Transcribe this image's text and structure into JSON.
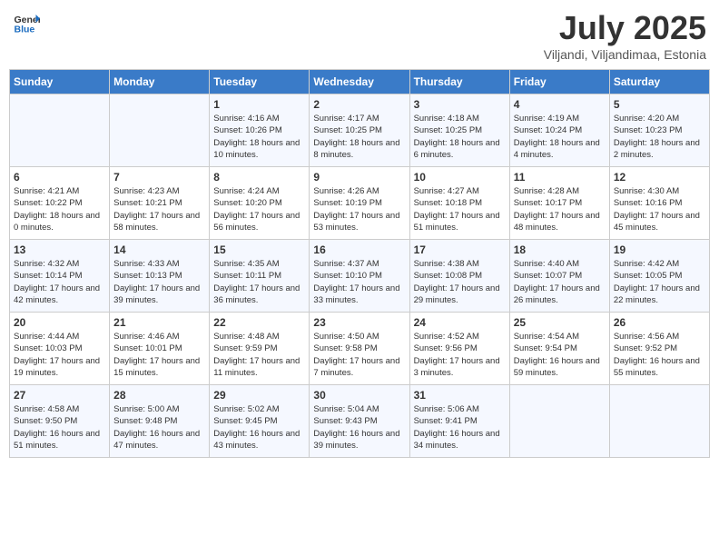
{
  "header": {
    "logo_general": "General",
    "logo_blue": "Blue",
    "month_title": "July 2025",
    "subtitle": "Viljandi, Viljandimaa, Estonia"
  },
  "days_of_week": [
    "Sunday",
    "Monday",
    "Tuesday",
    "Wednesday",
    "Thursday",
    "Friday",
    "Saturday"
  ],
  "weeks": [
    [
      {
        "day": "",
        "detail": ""
      },
      {
        "day": "",
        "detail": ""
      },
      {
        "day": "1",
        "detail": "Sunrise: 4:16 AM\nSunset: 10:26 PM\nDaylight: 18 hours\nand 10 minutes."
      },
      {
        "day": "2",
        "detail": "Sunrise: 4:17 AM\nSunset: 10:25 PM\nDaylight: 18 hours\nand 8 minutes."
      },
      {
        "day": "3",
        "detail": "Sunrise: 4:18 AM\nSunset: 10:25 PM\nDaylight: 18 hours\nand 6 minutes."
      },
      {
        "day": "4",
        "detail": "Sunrise: 4:19 AM\nSunset: 10:24 PM\nDaylight: 18 hours\nand 4 minutes."
      },
      {
        "day": "5",
        "detail": "Sunrise: 4:20 AM\nSunset: 10:23 PM\nDaylight: 18 hours\nand 2 minutes."
      }
    ],
    [
      {
        "day": "6",
        "detail": "Sunrise: 4:21 AM\nSunset: 10:22 PM\nDaylight: 18 hours\nand 0 minutes."
      },
      {
        "day": "7",
        "detail": "Sunrise: 4:23 AM\nSunset: 10:21 PM\nDaylight: 17 hours\nand 58 minutes."
      },
      {
        "day": "8",
        "detail": "Sunrise: 4:24 AM\nSunset: 10:20 PM\nDaylight: 17 hours\nand 56 minutes."
      },
      {
        "day": "9",
        "detail": "Sunrise: 4:26 AM\nSunset: 10:19 PM\nDaylight: 17 hours\nand 53 minutes."
      },
      {
        "day": "10",
        "detail": "Sunrise: 4:27 AM\nSunset: 10:18 PM\nDaylight: 17 hours\nand 51 minutes."
      },
      {
        "day": "11",
        "detail": "Sunrise: 4:28 AM\nSunset: 10:17 PM\nDaylight: 17 hours\nand 48 minutes."
      },
      {
        "day": "12",
        "detail": "Sunrise: 4:30 AM\nSunset: 10:16 PM\nDaylight: 17 hours\nand 45 minutes."
      }
    ],
    [
      {
        "day": "13",
        "detail": "Sunrise: 4:32 AM\nSunset: 10:14 PM\nDaylight: 17 hours\nand 42 minutes."
      },
      {
        "day": "14",
        "detail": "Sunrise: 4:33 AM\nSunset: 10:13 PM\nDaylight: 17 hours\nand 39 minutes."
      },
      {
        "day": "15",
        "detail": "Sunrise: 4:35 AM\nSunset: 10:11 PM\nDaylight: 17 hours\nand 36 minutes."
      },
      {
        "day": "16",
        "detail": "Sunrise: 4:37 AM\nSunset: 10:10 PM\nDaylight: 17 hours\nand 33 minutes."
      },
      {
        "day": "17",
        "detail": "Sunrise: 4:38 AM\nSunset: 10:08 PM\nDaylight: 17 hours\nand 29 minutes."
      },
      {
        "day": "18",
        "detail": "Sunrise: 4:40 AM\nSunset: 10:07 PM\nDaylight: 17 hours\nand 26 minutes."
      },
      {
        "day": "19",
        "detail": "Sunrise: 4:42 AM\nSunset: 10:05 PM\nDaylight: 17 hours\nand 22 minutes."
      }
    ],
    [
      {
        "day": "20",
        "detail": "Sunrise: 4:44 AM\nSunset: 10:03 PM\nDaylight: 17 hours\nand 19 minutes."
      },
      {
        "day": "21",
        "detail": "Sunrise: 4:46 AM\nSunset: 10:01 PM\nDaylight: 17 hours\nand 15 minutes."
      },
      {
        "day": "22",
        "detail": "Sunrise: 4:48 AM\nSunset: 9:59 PM\nDaylight: 17 hours\nand 11 minutes."
      },
      {
        "day": "23",
        "detail": "Sunrise: 4:50 AM\nSunset: 9:58 PM\nDaylight: 17 hours\nand 7 minutes."
      },
      {
        "day": "24",
        "detail": "Sunrise: 4:52 AM\nSunset: 9:56 PM\nDaylight: 17 hours\nand 3 minutes."
      },
      {
        "day": "25",
        "detail": "Sunrise: 4:54 AM\nSunset: 9:54 PM\nDaylight: 16 hours\nand 59 minutes."
      },
      {
        "day": "26",
        "detail": "Sunrise: 4:56 AM\nSunset: 9:52 PM\nDaylight: 16 hours\nand 55 minutes."
      }
    ],
    [
      {
        "day": "27",
        "detail": "Sunrise: 4:58 AM\nSunset: 9:50 PM\nDaylight: 16 hours\nand 51 minutes."
      },
      {
        "day": "28",
        "detail": "Sunrise: 5:00 AM\nSunset: 9:48 PM\nDaylight: 16 hours\nand 47 minutes."
      },
      {
        "day": "29",
        "detail": "Sunrise: 5:02 AM\nSunset: 9:45 PM\nDaylight: 16 hours\nand 43 minutes."
      },
      {
        "day": "30",
        "detail": "Sunrise: 5:04 AM\nSunset: 9:43 PM\nDaylight: 16 hours\nand 39 minutes."
      },
      {
        "day": "31",
        "detail": "Sunrise: 5:06 AM\nSunset: 9:41 PM\nDaylight: 16 hours\nand 34 minutes."
      },
      {
        "day": "",
        "detail": ""
      },
      {
        "day": "",
        "detail": ""
      }
    ]
  ]
}
